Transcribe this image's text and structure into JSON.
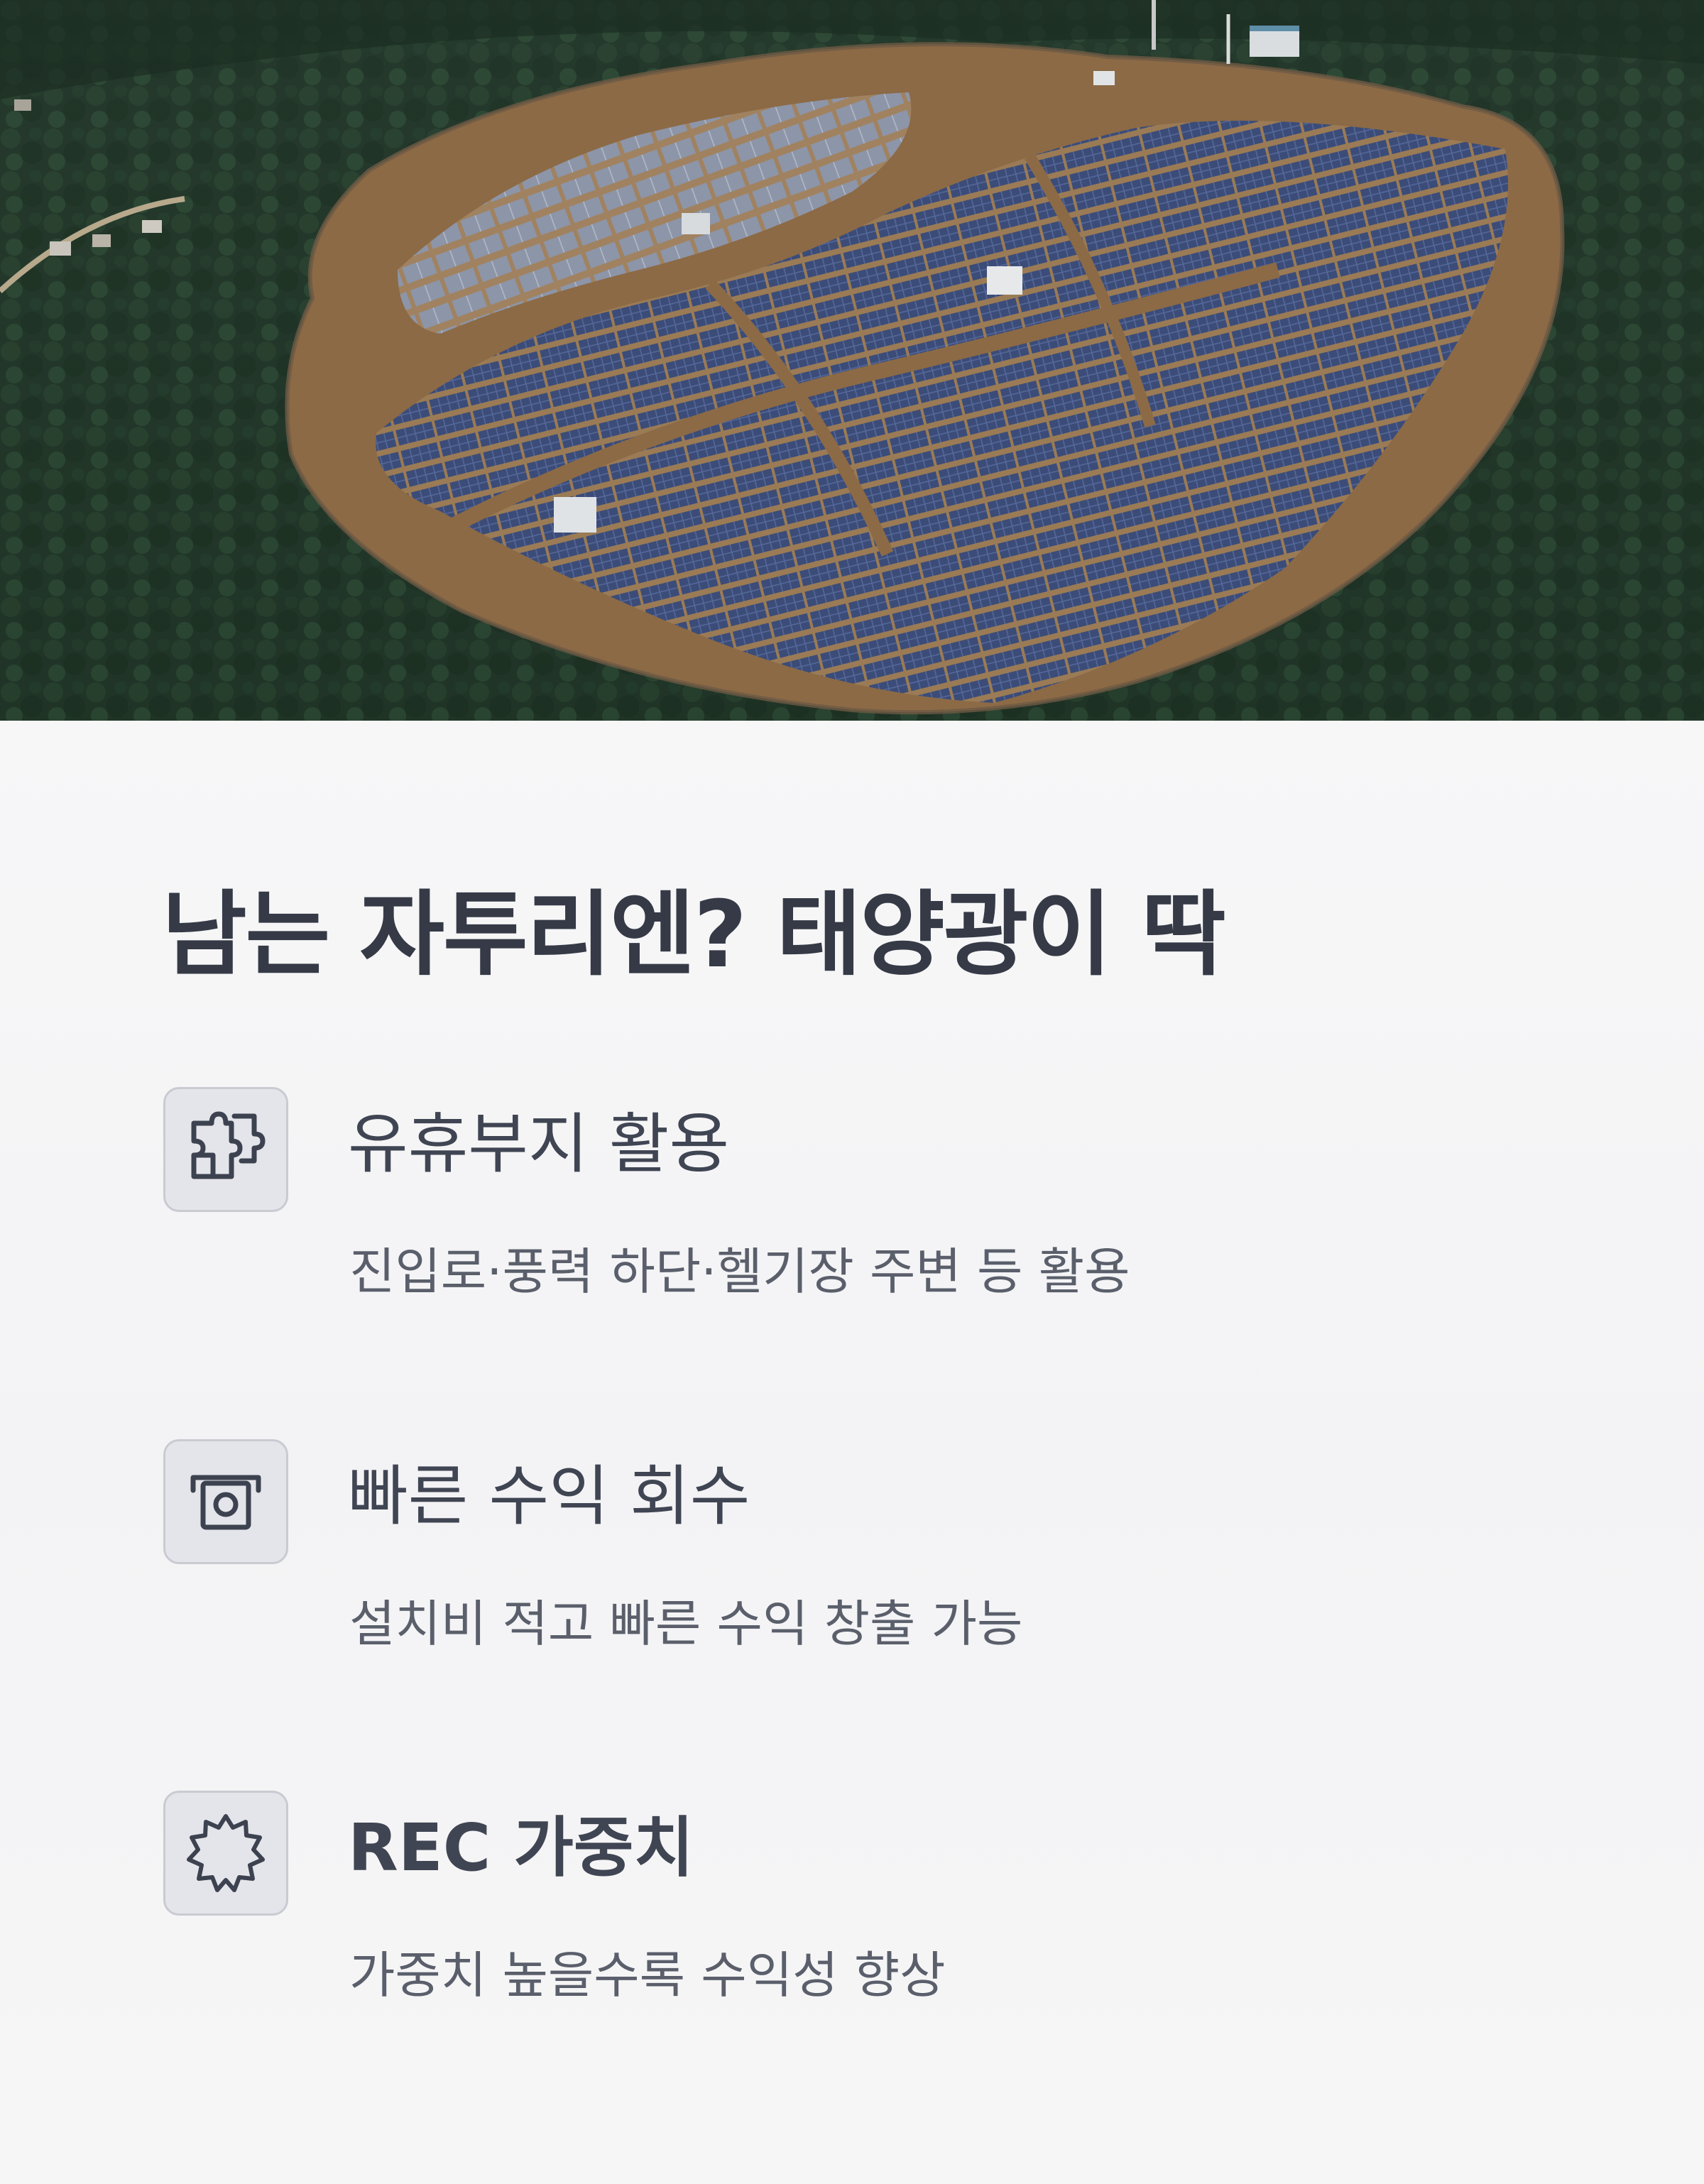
{
  "hero": {
    "image": "aerial-solar-farm-on-forested-hilltop"
  },
  "title": "남는 자투리엔? 태양광이 딱",
  "features": [
    {
      "icon": "puzzle-icon",
      "title": "유휴부지 활용",
      "description": "진입로·풍력 하단·헬기장 주변 등 활용"
    },
    {
      "icon": "cash-icon",
      "title": "빠른 수익 회수",
      "description": "설치비 적고 빠른 수익 창출 가능"
    },
    {
      "icon": "badge-icon",
      "title": "REC 가중치",
      "description": "가중치 높을수록 수익성 향상"
    }
  ],
  "colors": {
    "title_text": "#353a46",
    "body_text": "#5a5f6b",
    "icon_bg": "#e4e5ea",
    "icon_stroke": "#3d4250"
  }
}
